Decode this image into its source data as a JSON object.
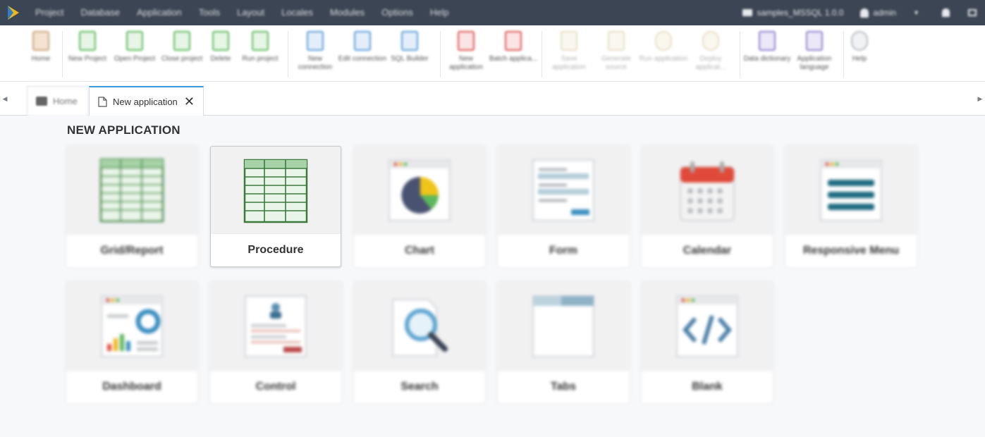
{
  "menu": {
    "items": [
      "Project",
      "Database",
      "Application",
      "Tools",
      "Layout",
      "Locales",
      "Modules",
      "Options",
      "Help"
    ],
    "project_label": "samples_MSSQL 1.0.0",
    "user_label": "admin"
  },
  "toolbar": {
    "buttons": [
      {
        "label": "Home",
        "icon": "home-icon"
      },
      {
        "label": "New Project",
        "icon": "new-project-icon"
      },
      {
        "label": "Open Project",
        "icon": "open-project-icon"
      },
      {
        "label": "Close project",
        "icon": "close-project-icon"
      },
      {
        "label": "Delete",
        "icon": "delete-icon"
      },
      {
        "label": "Run project",
        "icon": "run-project-icon"
      },
      {
        "label": "New connection",
        "icon": "new-connection-icon"
      },
      {
        "label": "Edit connection",
        "icon": "edit-connection-icon"
      },
      {
        "label": "SQL Builder",
        "icon": "sql-builder-icon"
      },
      {
        "label": "New application",
        "icon": "new-application-icon"
      },
      {
        "label": "Batch applica...",
        "icon": "batch-application-icon"
      },
      {
        "label": "Save application",
        "icon": "save-application-icon"
      },
      {
        "label": "Generate source",
        "icon": "generate-source-icon"
      },
      {
        "label": "Run application",
        "icon": "run-application-icon"
      },
      {
        "label": "Deploy applicat...",
        "icon": "deploy-application-icon"
      },
      {
        "label": "Data dictionary",
        "icon": "data-dictionary-icon"
      },
      {
        "label": "Application language",
        "icon": "application-language-icon"
      },
      {
        "label": "Help",
        "icon": "help-icon"
      }
    ]
  },
  "tabs": {
    "home": "Home",
    "active": "New application"
  },
  "page": {
    "title": "NEW APPLICATION"
  },
  "cards": [
    {
      "label": "Grid/Report",
      "icon": "grid-report-icon"
    },
    {
      "label": "Procedure",
      "icon": "procedure-icon"
    },
    {
      "label": "Chart",
      "icon": "chart-icon"
    },
    {
      "label": "Form",
      "icon": "form-icon"
    },
    {
      "label": "Calendar",
      "icon": "calendar-icon"
    },
    {
      "label": "Responsive Menu",
      "icon": "responsive-menu-icon"
    },
    {
      "label": "Dashboard",
      "icon": "dashboard-icon"
    },
    {
      "label": "Control",
      "icon": "control-icon"
    },
    {
      "label": "Search",
      "icon": "search-icon"
    },
    {
      "label": "Tabs",
      "icon": "tabs-icon"
    },
    {
      "label": "Blank",
      "icon": "blank-icon"
    }
  ],
  "colors": {
    "menubar_bg": "#3b4553",
    "active_tab_accent": "#3b9ad9",
    "grid_green": "#4a8a4a",
    "calendar_red": "#e04a3a",
    "menu_teal": "#1f6b80"
  }
}
